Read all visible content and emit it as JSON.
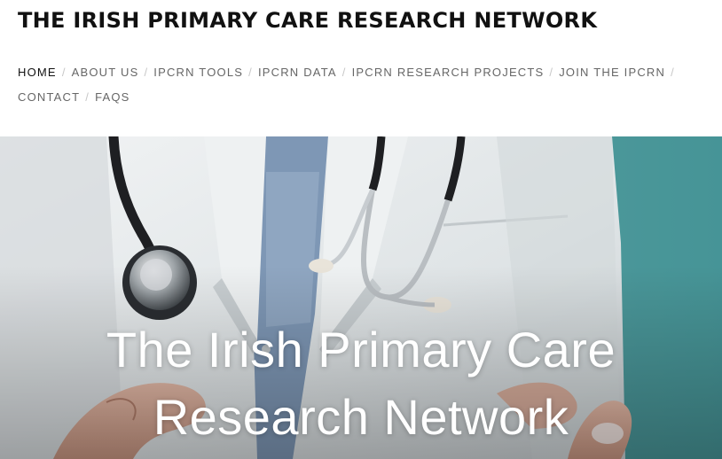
{
  "site": {
    "title": "THE IRISH PRIMARY CARE RESEARCH NETWORK"
  },
  "nav": {
    "separator": "/",
    "items": [
      {
        "label": "HOME",
        "active": true
      },
      {
        "label": "ABOUT US"
      },
      {
        "label": "IPCRN TOOLS"
      },
      {
        "label": "IPCRN DATA"
      },
      {
        "label": "IPCRN RESEARCH PROJECTS"
      },
      {
        "label": "JOIN THE IPCRN"
      },
      {
        "label": "CONTACT"
      },
      {
        "label": "FAQS"
      }
    ]
  },
  "hero": {
    "title_line1": "The Irish Primary Care",
    "title_line2": "Research Network"
  },
  "colors": {
    "title_text": "#111111",
    "nav_text": "#666666",
    "nav_active": "#111111",
    "hero_teal": "#5aa2a4",
    "coat_white": "#e9ecee"
  }
}
